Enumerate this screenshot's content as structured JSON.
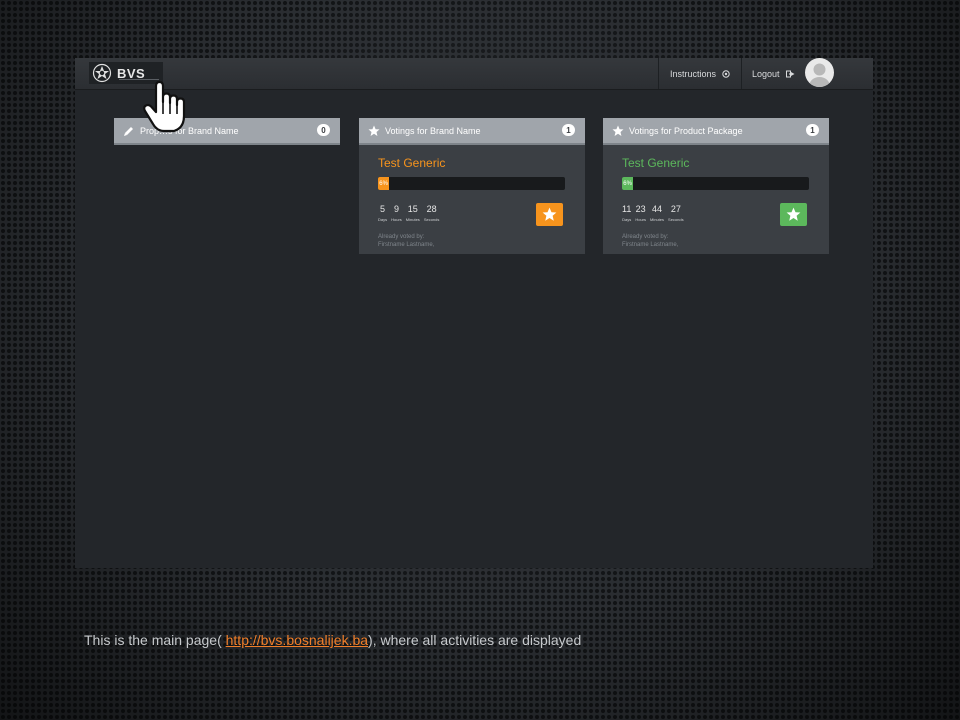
{
  "app": {
    "logo_text": "BVS",
    "nav": {
      "instructions_label": "Instructions",
      "logout_label": "Logout"
    }
  },
  "cards": [
    {
      "title": "Prop…s for Brand Name",
      "badge": "0",
      "icon": "pencil-icon"
    },
    {
      "title": "Votings for Brand Name",
      "badge": "1",
      "icon": "star-icon",
      "item_title": "Test Generic",
      "progress_label": "6%",
      "progress": 0.06,
      "accent": "#f7941d",
      "timer": [
        {
          "value": "5",
          "label": "Days"
        },
        {
          "value": "9",
          "label": "Hours"
        },
        {
          "value": "15",
          "label": "Minutes"
        },
        {
          "value": "28",
          "label": "Seconds"
        }
      ],
      "voted_label": "Already voted by:",
      "voted_names": "Firstname Lastname,"
    },
    {
      "title": "Votings for Product Package",
      "badge": "1",
      "icon": "star-icon",
      "item_title": "Test Generic",
      "progress_label": "6%",
      "progress": 0.06,
      "accent": "#5cb85c",
      "timer": [
        {
          "value": "11",
          "label": "Days"
        },
        {
          "value": "23",
          "label": "Hours"
        },
        {
          "value": "44",
          "label": "Minutes"
        },
        {
          "value": "27",
          "label": "Seconds"
        }
      ],
      "voted_label": "Already voted by:",
      "voted_names": "Firstname Lastname,"
    }
  ],
  "caption": {
    "prefix": "This is the main page( ",
    "link": "http://bvs.bosnalijek.ba",
    "suffix": "),  where all activities are displayed"
  }
}
